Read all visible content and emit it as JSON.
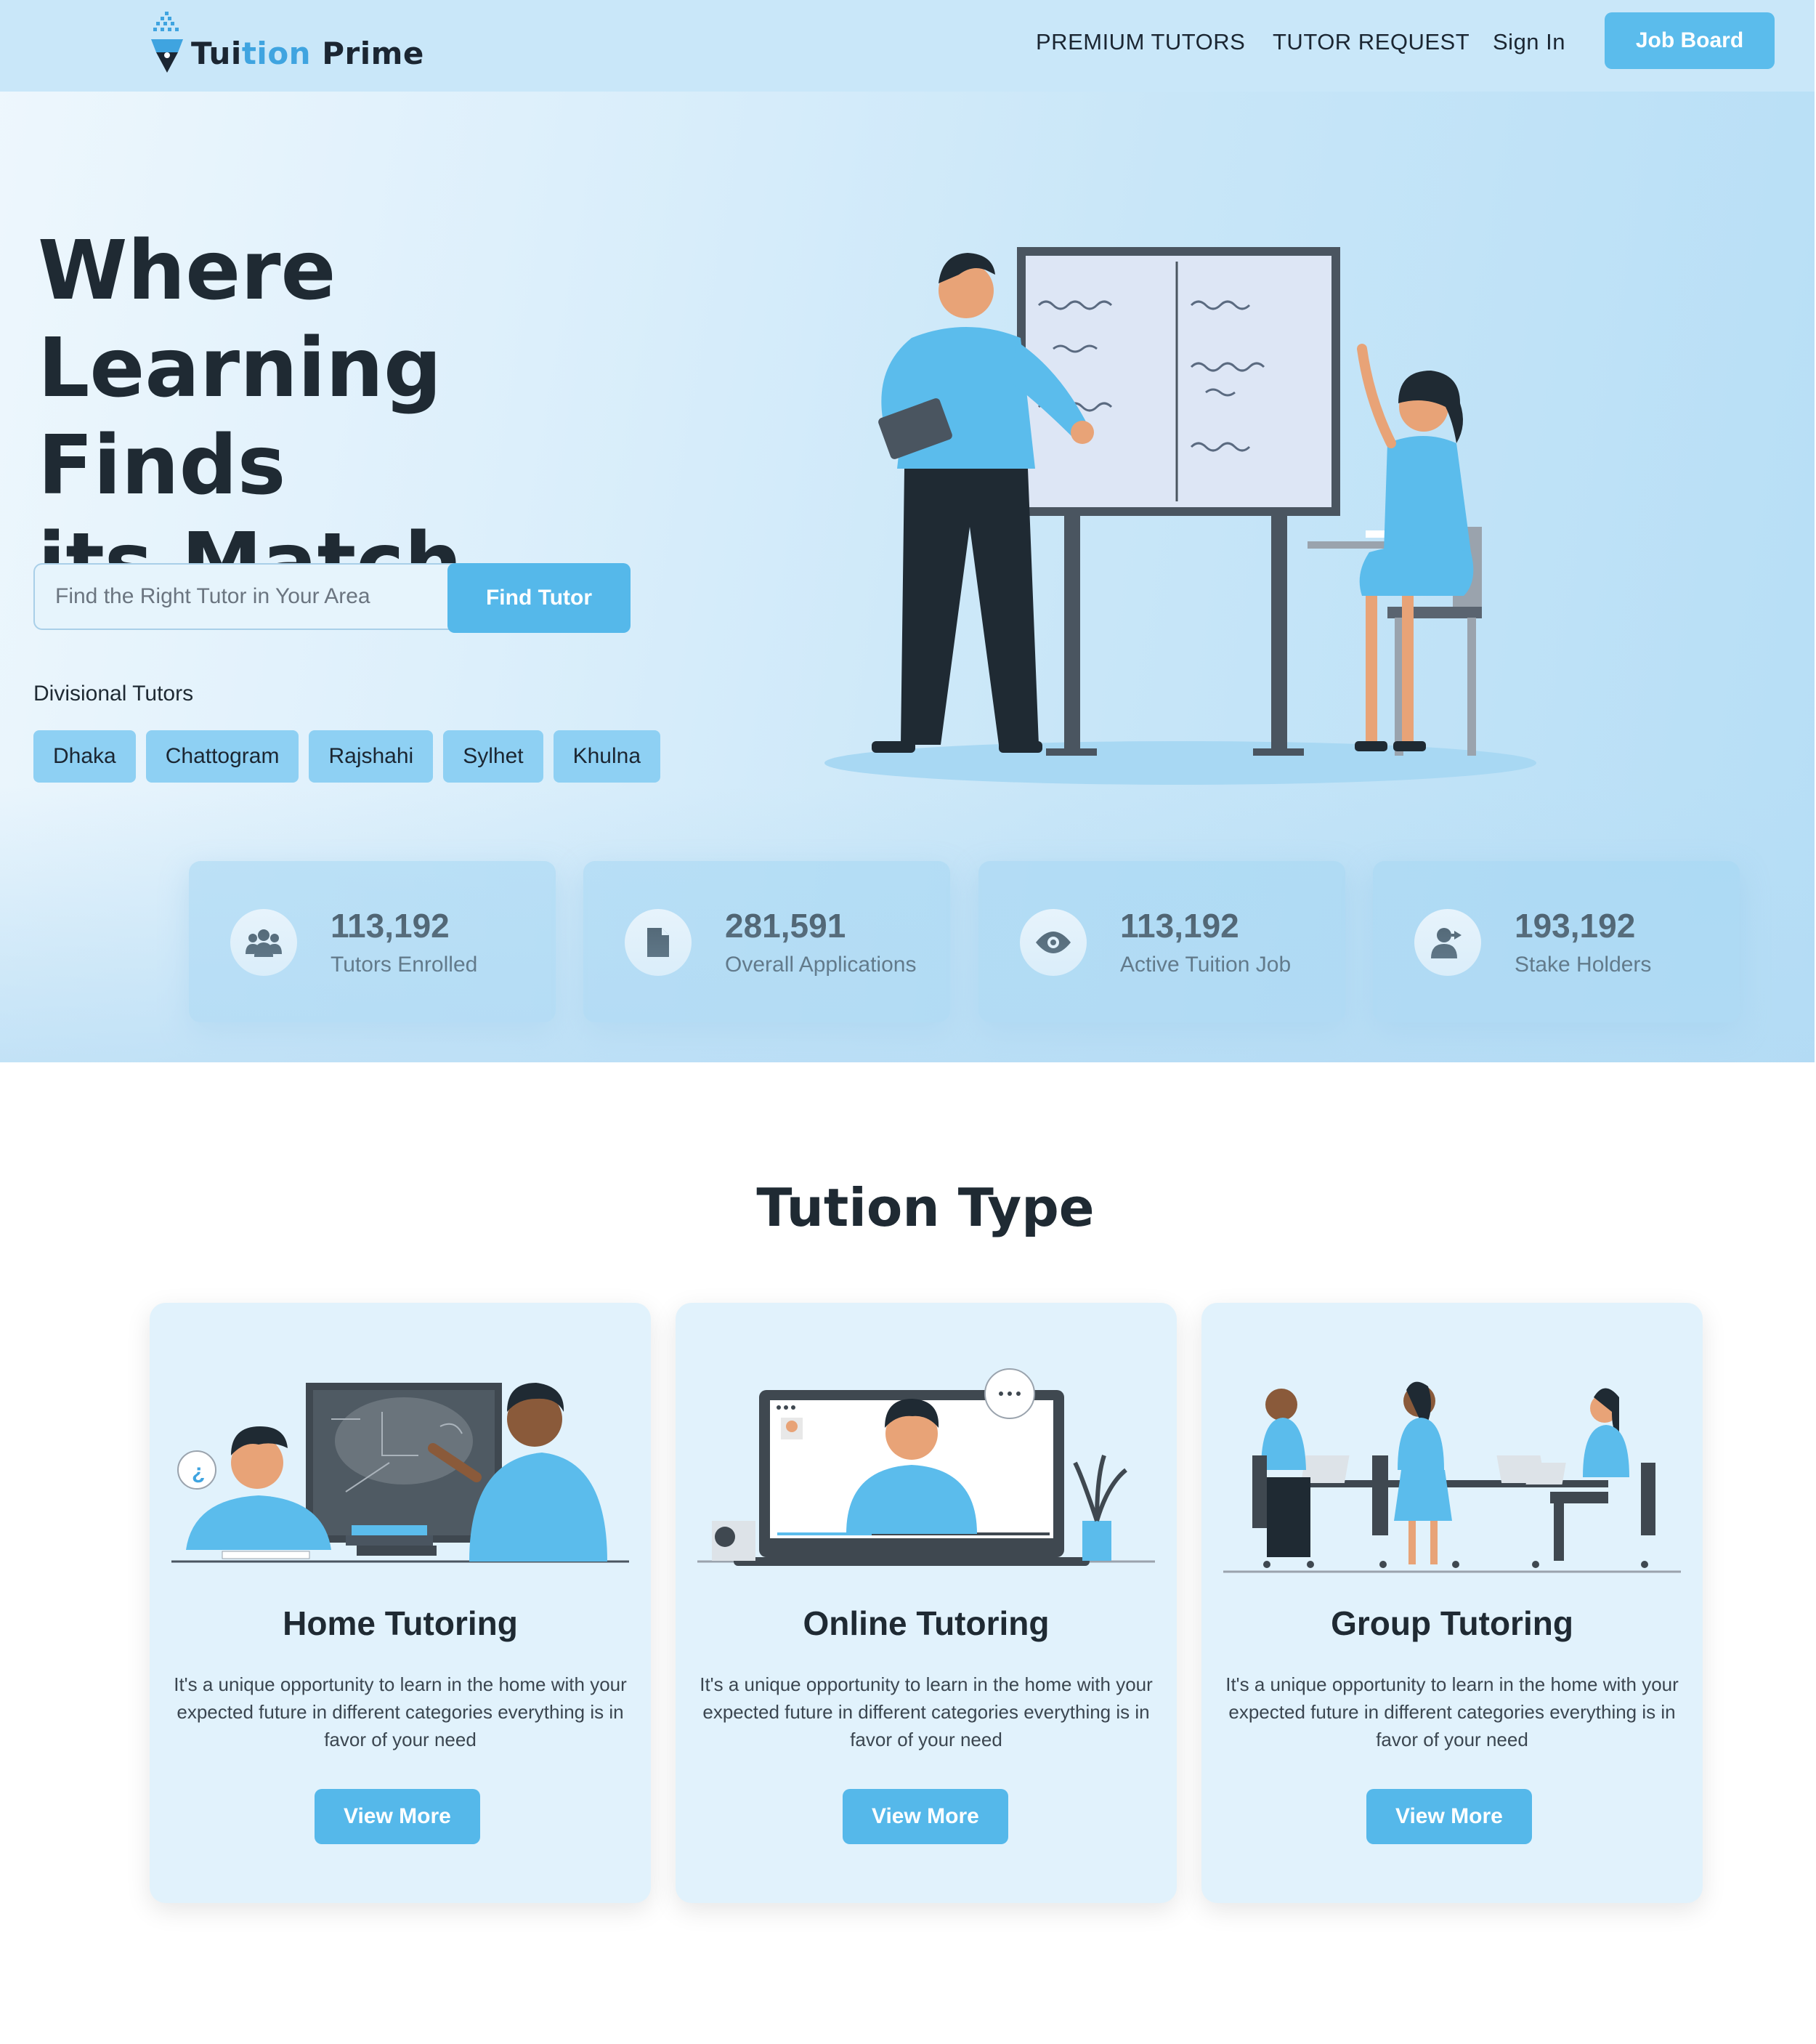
{
  "brand": {
    "logo_text_prefix": "Tui",
    "logo_text_highlight": "tion",
    "logo_text_suffix": " Prime",
    "accent_color": "#5bbcec"
  },
  "nav": {
    "premium_tutors": "PREMIUM TUTORS",
    "tutor_request": "TUTOR REQUEST",
    "sign_in": "Sign In",
    "job_board": "Job Board"
  },
  "hero": {
    "headline_line1": "Where",
    "headline_line2": "Learning Finds",
    "headline_line3": "its Match",
    "search_placeholder": "Find the Right Tutor in Your Area",
    "find_button": "Find Tutor",
    "divisional_label": "Divisional Tutors",
    "divisions": [
      "Dhaka",
      "Chattogram",
      "Rajshahi",
      "Sylhet",
      "Khulna"
    ]
  },
  "stats": [
    {
      "value": "113,192",
      "label": "Tutors Enrolled",
      "icon": "users-icon"
    },
    {
      "value": "281,591",
      "label": "Overall Applications",
      "icon": "file-icon"
    },
    {
      "value": "113,192",
      "label": "Active Tuition Job",
      "icon": "eye-icon"
    },
    {
      "value": "193,192",
      "label": "Stake Holders",
      "icon": "user-share-icon"
    }
  ],
  "tuition_type": {
    "title": "Tution Type",
    "cards": [
      {
        "title": "Home Tutoring",
        "description": "It's a unique opportunity to learn in the home with your expected future in different categories everything is in favor of your need",
        "button": "View More"
      },
      {
        "title": "Online Tutoring",
        "description": "It's a unique opportunity to learn in the home with your expected future in different categories everything is in favor of your need",
        "button": "View More"
      },
      {
        "title": "Group Tutoring",
        "description": "It's a unique opportunity to learn in the home with your expected future in different categories everything is in favor of your need",
        "button": "View More"
      }
    ]
  }
}
